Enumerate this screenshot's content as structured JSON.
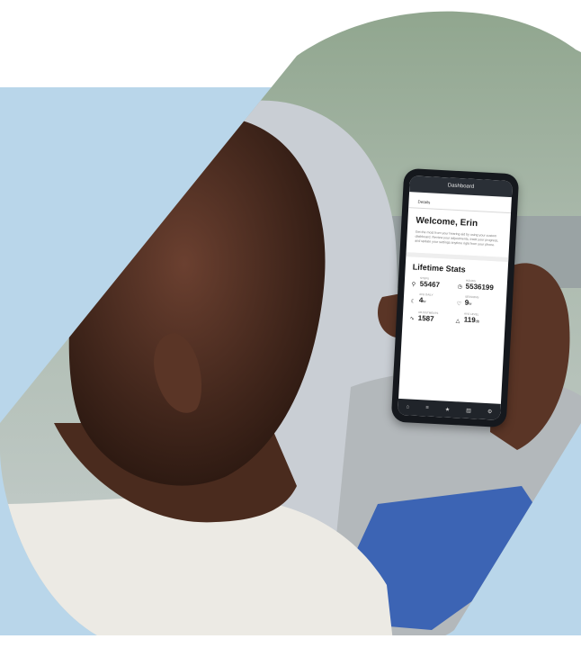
{
  "scene": {
    "colors": {
      "band": "#b9d6ea",
      "shirt": "#eceae4",
      "sleeve": "#3c64b4",
      "skin": "#5a3526",
      "phone": "#15181d"
    }
  },
  "phone": {
    "header_title": "Dashboard",
    "tab": "Details",
    "welcome_title": "Welcome, Erin",
    "welcome_body": "Get the most from your hearing aid by using your custom dashboard. Review your adjustments, track your progress, and update your settings anytime right from your phone.",
    "stats_title": "Lifetime Stats",
    "stats": [
      {
        "label": "STEPS",
        "value": "55467",
        "unit": "",
        "icon": "shoe-icon"
      },
      {
        "label": "HOURS",
        "value": "5536199",
        "unit": "",
        "icon": "clock-icon"
      },
      {
        "label": "AVG DAILY",
        "value": "4",
        "unit": "hr",
        "icon": "moon-icon"
      },
      {
        "label": "SESSIONS",
        "value": "9",
        "unit": "hr",
        "icon": "heart-icon"
      },
      {
        "label": "ADJUSTMENTS",
        "value": "1587",
        "unit": "",
        "icon": "wave-icon"
      },
      {
        "label": "AVG LEVEL",
        "value": "119",
        "unit": "db",
        "icon": "triangle-icon"
      }
    ],
    "nav_icons": [
      "home-icon",
      "list-icon",
      "star-icon",
      "chart-icon",
      "settings-icon"
    ]
  }
}
